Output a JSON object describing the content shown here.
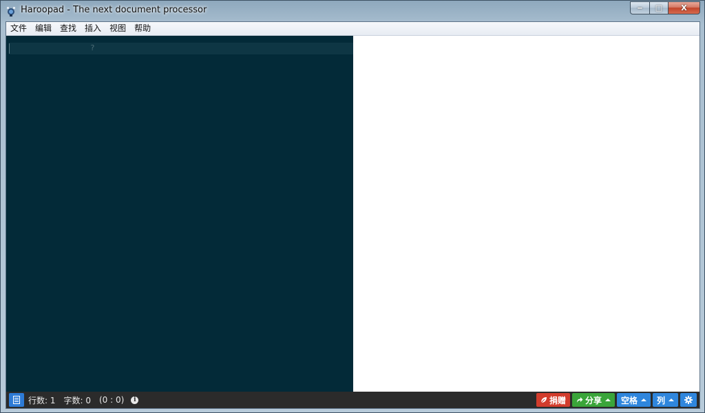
{
  "window": {
    "title": "Haroopad - The next document processor",
    "controls": {
      "minimize": "‒",
      "maximize": "□",
      "close": "X"
    }
  },
  "menu": {
    "items": [
      {
        "label": "文件"
      },
      {
        "label": "编辑"
      },
      {
        "label": "查找"
      },
      {
        "label": "插入"
      },
      {
        "label": "视图"
      },
      {
        "label": "帮助"
      }
    ]
  },
  "editor": {
    "placeholder": "?",
    "background": "#032a38"
  },
  "statusbar": {
    "lines": "行数: 1",
    "chars": "字数: 0",
    "position": "(0 : 0)",
    "buttons": {
      "donate": "捐赠",
      "share": "分享",
      "space": "空格",
      "columns": "列"
    },
    "colors": {
      "donate": "#d23c2c",
      "share": "#3aa53a",
      "blue": "#2f86dd"
    }
  },
  "icons": {
    "app": "haroopad-logo-icon",
    "toggle": "document-icon",
    "info": "info-icon",
    "donate": "leaf-icon",
    "share": "share-arrow-icon",
    "settings": "gear-icon"
  }
}
